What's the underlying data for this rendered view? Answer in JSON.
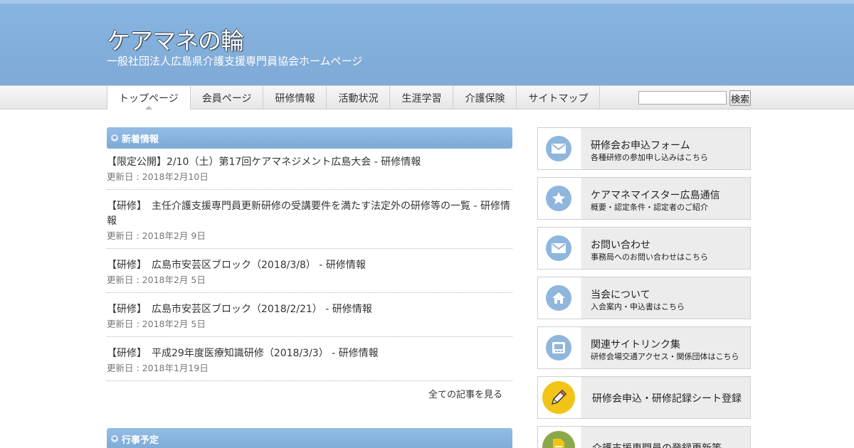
{
  "header": {
    "title": "ケアマネの輪",
    "subtitle": "一般社団法人広島県介護支援専門員協会ホームページ"
  },
  "nav": {
    "items": [
      {
        "label": "トップページ",
        "active": true
      },
      {
        "label": "会員ページ"
      },
      {
        "label": "研修情報"
      },
      {
        "label": "活動状況"
      },
      {
        "label": "生涯学習"
      },
      {
        "label": "介護保険"
      },
      {
        "label": "サイトマップ"
      }
    ],
    "search_placeholder": "",
    "search_button": "検索"
  },
  "news": {
    "heading": "新着情報",
    "items": [
      {
        "title": "【限定公開】2/10（土）第17回ケアマネジメント広島大会 - 研修情報",
        "date": "更新日 : 2018年2月10日"
      },
      {
        "title": "【研修】　主任介護支援専門員更新研修の受講要件を満たす法定外の研修等の一覧 - 研修情報",
        "date": "更新日 : 2018年2月 9日"
      },
      {
        "title": "【研修】　広島市安芸区ブロック（2018/3/8） - 研修情報",
        "date": "更新日 : 2018年2月 5日"
      },
      {
        "title": "【研修】　広島市安芸区ブロック（2018/2/21） - 研修情報",
        "date": "更新日 : 2018年2月 5日"
      },
      {
        "title": "【研修】　平成29年度医療知識研修（2018/3/3） - 研修情報",
        "date": "更新日 : 2018年1月19日"
      }
    ],
    "all_link": "全ての記事を見る"
  },
  "events": {
    "heading": "行事予定"
  },
  "sidebar": {
    "banners": [
      {
        "title": "研修会お申込フォーム",
        "desc": "各種研修の参加申し込みはこちら",
        "icon": "envelope-icon"
      },
      {
        "title": "ケアマネマイスター広島通信",
        "desc": "概要・認定条件・認定者のご紹介",
        "icon": "star-icon"
      },
      {
        "title": "お問い合わせ",
        "desc": "事務局へのお問い合わせはこちら",
        "icon": "envelope-icon"
      },
      {
        "title": "当会について",
        "desc": "入会案内・申込書はこちら",
        "icon": "home-icon"
      },
      {
        "title": "関連サイトリンク集",
        "desc": "研修会場交通アクセス・関係団体はこちら",
        "icon": "screen-icon"
      },
      {
        "title": "研修会申込・研修記録シート登録",
        "icon": "pencil-icon"
      },
      {
        "title": "介護支援専門員の登録更新等",
        "icon": "document-icon"
      }
    ]
  },
  "colors": {
    "header_bg": "#7fa9d6",
    "section_header": "#86b2de",
    "icon_blue": "#8fb6dc",
    "icon_yellow": "#f2c418",
    "icon_green": "#8aa84a"
  }
}
